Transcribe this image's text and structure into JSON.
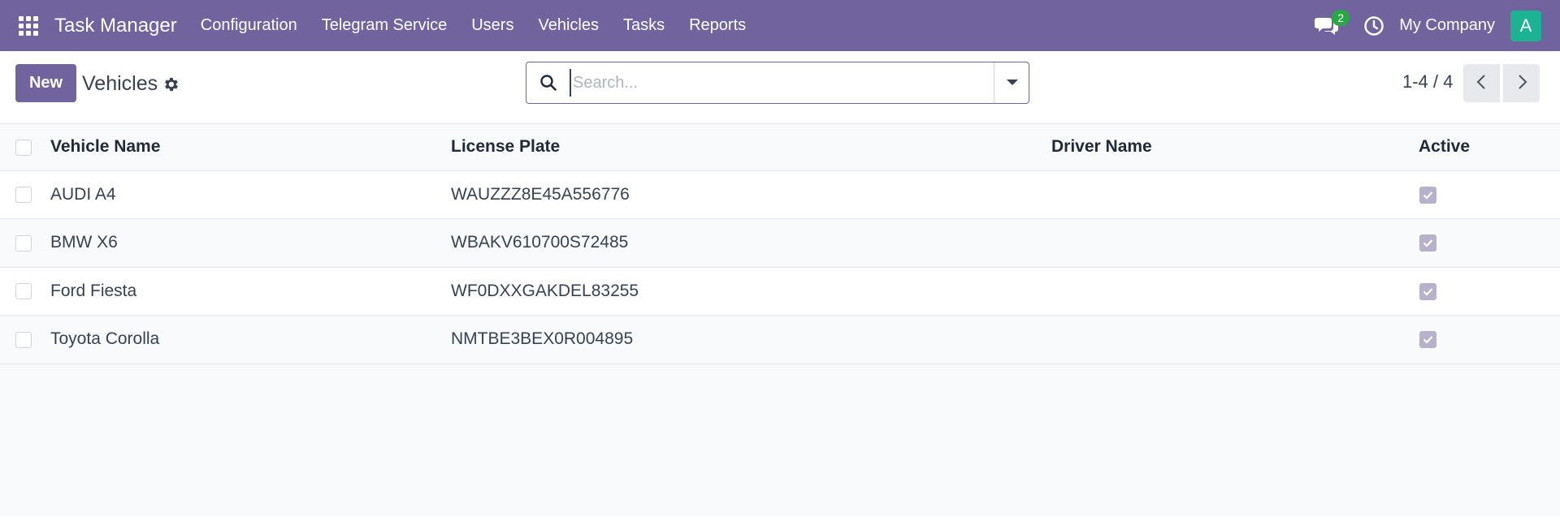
{
  "navbar": {
    "brand": "Task Manager",
    "menu": [
      "Configuration",
      "Telegram Service",
      "Users",
      "Vehicles",
      "Tasks",
      "Reports"
    ],
    "chat_count": "2",
    "company": "My Company",
    "avatar_letter": "A"
  },
  "control": {
    "new_label": "New",
    "title": "Vehicles",
    "search_placeholder": "Search...",
    "pager": "1-4 / 4"
  },
  "table": {
    "columns": [
      "Vehicle Name",
      "License Plate",
      "Driver Name",
      "Active"
    ],
    "rows": [
      {
        "name": "AUDI A4",
        "plate": "WAUZZZ8E45A556776",
        "driver": "",
        "active": true
      },
      {
        "name": "BMW X6",
        "plate": "WBAKV610700S72485",
        "driver": "",
        "active": true
      },
      {
        "name": "Ford Fiesta",
        "plate": "WF0DXXGAKDEL83255",
        "driver": "",
        "active": true
      },
      {
        "name": "Toyota Corolla",
        "plate": "NMTBE3BEX0R004895",
        "driver": "",
        "active": true
      }
    ]
  },
  "colors": {
    "navbar": "#71639e",
    "badge": "#28a745",
    "avatar": "#1bb394"
  }
}
